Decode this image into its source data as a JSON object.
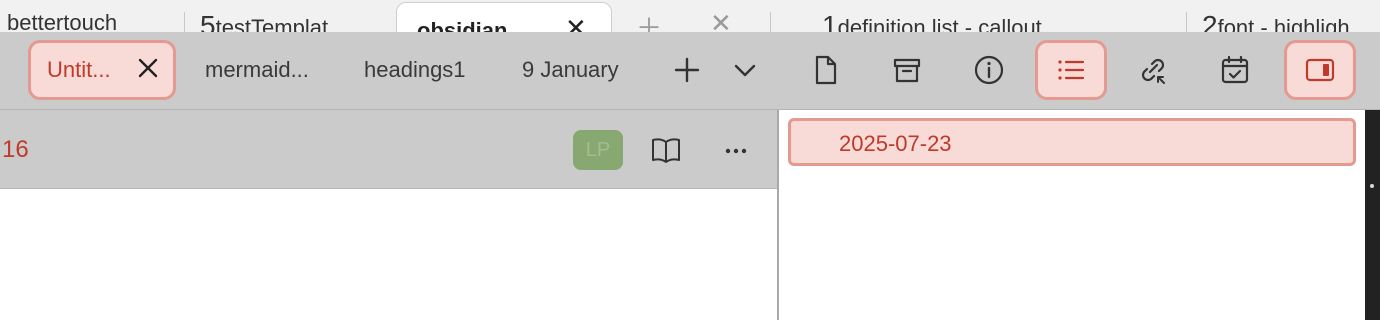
{
  "browser_tabs": {
    "tab1": "l bettertouch",
    "tab2_num": "5",
    "tab2": "testTemplat",
    "active": "obsidian",
    "tab4_num": "1",
    "tab4": "definition list - callout",
    "tab5_num": "2",
    "tab5": "font - highligh"
  },
  "tabs": [
    {
      "label": "Untit..."
    },
    {
      "label": "mermaid..."
    },
    {
      "label": "headings1"
    },
    {
      "label": "9 January"
    }
  ],
  "note": {
    "title_fragment": "16",
    "mode_badge": "LP"
  },
  "sidebar": {
    "date_item": "2025-07-23"
  },
  "colors": {
    "accent": "#c0392b",
    "highlight_bg": "#f8dbd6",
    "highlight_border": "#e49a91",
    "toolbar_bg": "#cbcbcb"
  },
  "icons": [
    "close-icon",
    "new-tab-icon",
    "chevron-down-icon",
    "file-icon",
    "archive-icon",
    "info-icon",
    "list-icon",
    "link-icon",
    "calendar-icon",
    "sidebar-toggle-icon",
    "book-icon",
    "more-icon"
  ]
}
